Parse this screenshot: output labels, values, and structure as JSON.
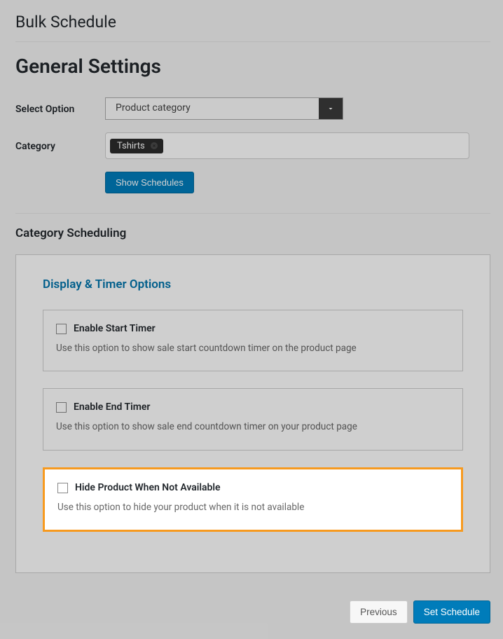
{
  "page_title": "Bulk Schedule",
  "section_heading": "General Settings",
  "form": {
    "select_option_label": "Select Option",
    "select_option_value": "Product category",
    "category_label": "Category",
    "category_tag": "Tshirts",
    "show_schedules_btn": "Show Schedules"
  },
  "subheading": "Category Scheduling",
  "panel_title": "Display & Timer Options",
  "options": {
    "start_timer": {
      "label": "Enable Start Timer",
      "desc": "Use this option to show sale start countdown timer on the product page"
    },
    "end_timer": {
      "label": "Enable End Timer",
      "desc": "Use this option to show sale end countdown timer on your product page"
    },
    "hide_product": {
      "label": "Hide Product When Not Available",
      "desc": "Use this option to hide your product when it is not available"
    }
  },
  "footer": {
    "previous": "Previous",
    "set_schedule": "Set Schedule"
  }
}
